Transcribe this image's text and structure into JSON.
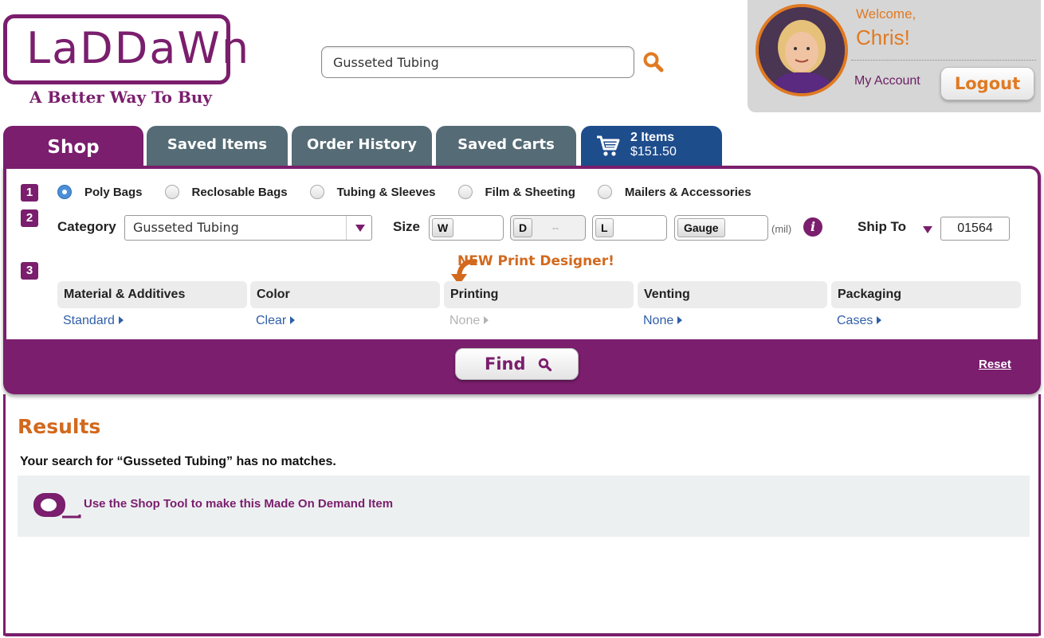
{
  "brand": {
    "logo_text": "LaDDaWn",
    "tagline": "A Better Way To Buy",
    "color": "#7a1e6d",
    "accent": "#e07a22"
  },
  "search": {
    "value": "Gusseted Tubing",
    "icon": "search-icon"
  },
  "account": {
    "welcome": "Welcome,",
    "name": "Chris!",
    "my_account": "My Account",
    "logout": "Logout"
  },
  "tabs": [
    {
      "label": "Shop",
      "active": true
    },
    {
      "label": "Saved Items"
    },
    {
      "label": "Order History"
    },
    {
      "label": "Saved Carts"
    }
  ],
  "cart": {
    "count": "2 Items",
    "total": "$151.50",
    "icon": "cart-icon"
  },
  "shop": {
    "step1": "1",
    "step2": "2",
    "step3": "3",
    "product_types": [
      {
        "label": "Poly Bags",
        "selected": true
      },
      {
        "label": "Reclosable Bags",
        "selected": false
      },
      {
        "label": "Tubing & Sleeves",
        "selected": false
      },
      {
        "label": "Film & Sheeting",
        "selected": false
      },
      {
        "label": "Mailers & Accessories",
        "selected": false
      }
    ],
    "category_label": "Category",
    "category_value": "Gusseted Tubing",
    "size_label": "Size",
    "w": "W",
    "d": "D",
    "d_placeholder": "--",
    "l": "L",
    "gauge": "Gauge",
    "gauge_unit": "(mil)",
    "ship_to_label": "Ship To",
    "zip": "01564",
    "print_designer": "NEW Print Designer!",
    "options": [
      {
        "header": "Material & Additives",
        "value": "Standard",
        "enabled": true
      },
      {
        "header": "Color",
        "value": "Clear",
        "enabled": true
      },
      {
        "header": "Printing",
        "value": "None",
        "enabled": false
      },
      {
        "header": "Venting",
        "value": "None",
        "enabled": true
      },
      {
        "header": "Packaging",
        "value": "Cases",
        "enabled": true
      }
    ],
    "find": "Find",
    "reset": "Reset"
  },
  "results": {
    "title": "Results",
    "message": "Your search for  “Gusseted Tubing” has no matches.",
    "made_on_demand": "Use the Shop Tool to make this Made On Demand Item"
  }
}
